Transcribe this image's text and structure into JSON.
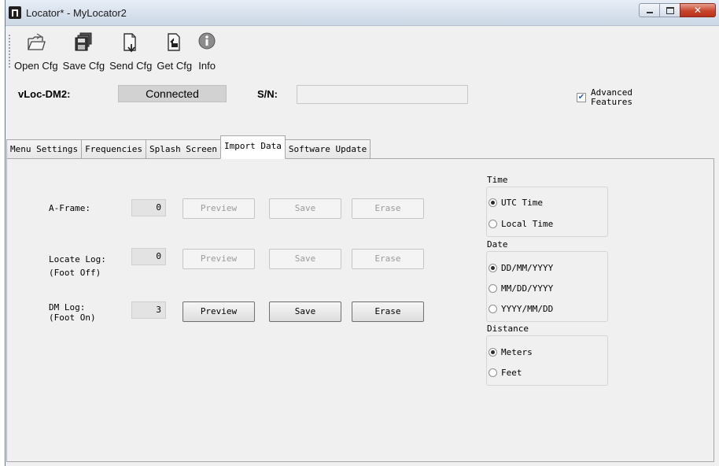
{
  "window": {
    "title": "Locator* - MyLocator2"
  },
  "toolbar": {
    "buttons": [
      {
        "label": "Open Cfg",
        "icon": "open-folder-icon"
      },
      {
        "label": "Save Cfg",
        "icon": "save-disk-icon"
      },
      {
        "label": "Send Cfg",
        "icon": "send-document-icon"
      },
      {
        "label": "Get Cfg",
        "icon": "get-document-icon"
      },
      {
        "label": "Info",
        "icon": "info-icon"
      }
    ]
  },
  "device": {
    "label": "vLoc-DM2:",
    "status": "Connected",
    "sn_label": "S/N:",
    "sn_value": "",
    "advanced_label_1": "Advanced",
    "advanced_label_2": "Features",
    "advanced_checked": true
  },
  "tabs": [
    "Menu Settings",
    "Frequencies",
    "Splash Screen",
    "Import Data",
    "Software Update"
  ],
  "active_tab": "Import Data",
  "import": {
    "rows": [
      {
        "label1": "A-Frame:",
        "label2": "",
        "count": "0",
        "enabled": false
      },
      {
        "label1": "Locate Log:",
        "label2": "(Foot Off)",
        "count": "0",
        "enabled": false
      },
      {
        "label1": "DM Log:",
        "label2": "(Foot On)",
        "count": "3",
        "enabled": true
      }
    ],
    "buttons": {
      "preview": "Preview",
      "save": "Save",
      "erase": "Erase"
    }
  },
  "time_group": {
    "title": "Time",
    "options": [
      "UTC Time",
      "Local Time"
    ],
    "selected": "UTC Time"
  },
  "date_group": {
    "title": "Date",
    "options": [
      "DD/MM/YYYY",
      "MM/DD/YYYY",
      "YYYY/MM/DD"
    ],
    "selected": "DD/MM/YYYY"
  },
  "distance_group": {
    "title": "Distance",
    "options": [
      "Meters",
      "Feet"
    ],
    "selected": "Meters"
  },
  "colors": {
    "titlebar": "#d6e0ec",
    "close_button": "#c8452c",
    "panel": "#f0f0f0"
  }
}
